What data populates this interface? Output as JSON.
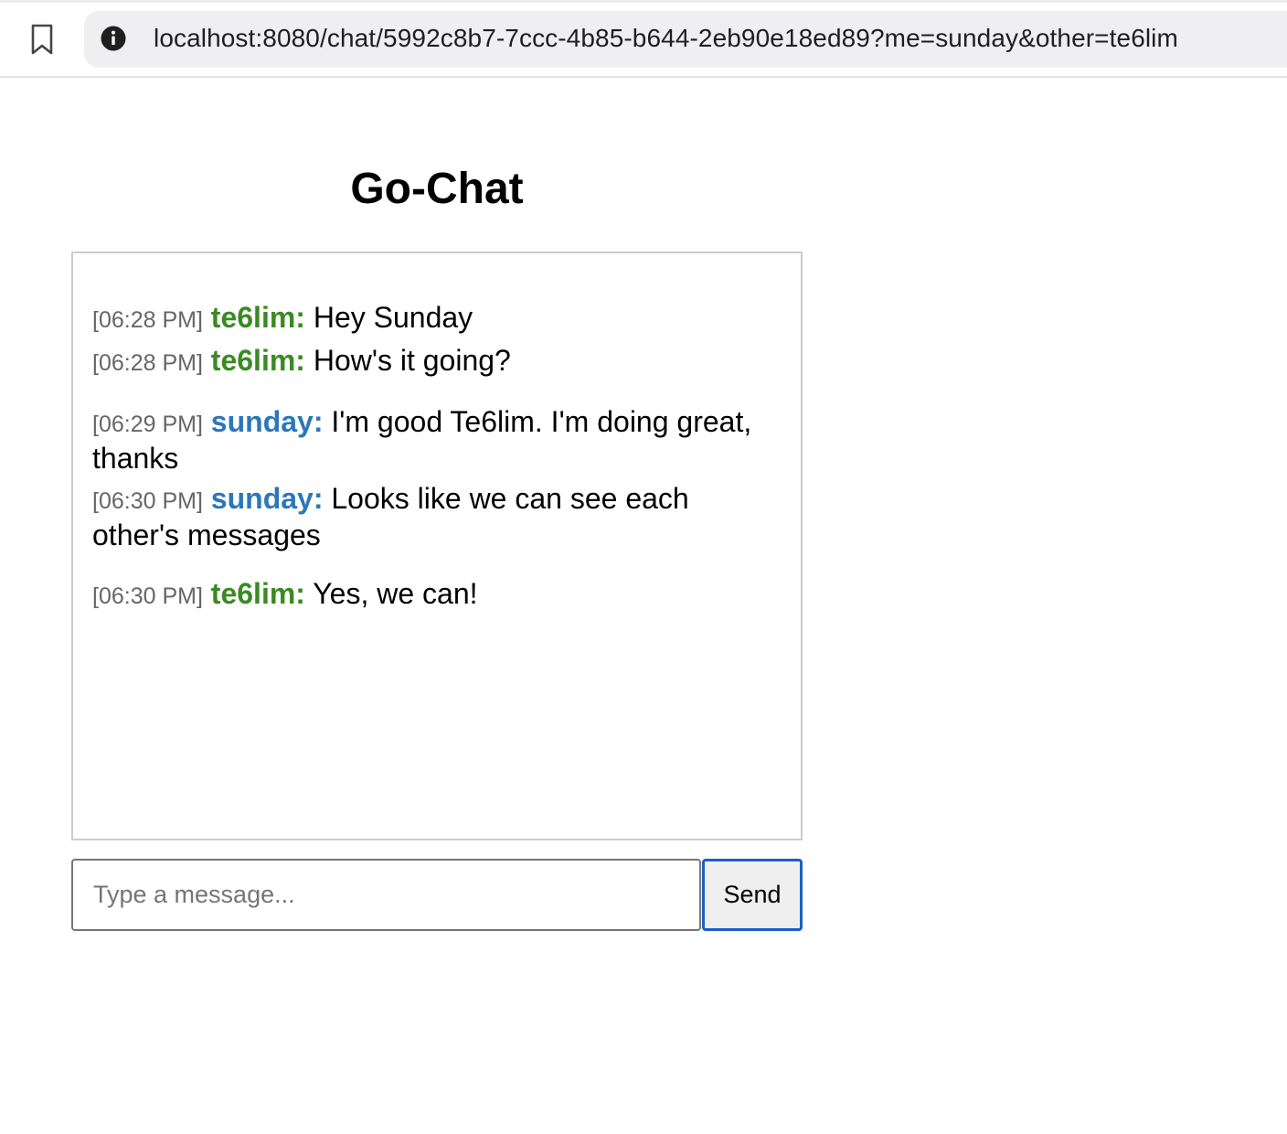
{
  "browser": {
    "url": "localhost:8080/chat/5992c8b7-7ccc-4b85-b644-2eb90e18ed89?me=sunday&other=te6lim"
  },
  "page": {
    "title": "Go-Chat"
  },
  "colors": {
    "other_user": "#3a8a24",
    "me_user": "#2b77b9",
    "timestamp": "#666666",
    "send_border": "#1a5fc8"
  },
  "messages": [
    {
      "time": "[06:28 PM]",
      "user": "te6lim:",
      "text": "Hey Sunday"
    },
    {
      "time": "[06:28 PM]",
      "user": "te6lim:",
      "text": "How's it going?"
    },
    {
      "time": "[06:29 PM]",
      "user": "sunday:",
      "text": "I'm good Te6lim. I'm doing great, thanks"
    },
    {
      "time": "[06:30 PM]",
      "user": "sunday:",
      "text": "Looks like we can see each other's messages"
    },
    {
      "time": "[06:30 PM]",
      "user": "te6lim:",
      "text": "Yes, we can!"
    }
  ],
  "composer": {
    "placeholder": "Type a message...",
    "value": "",
    "send_label": "Send"
  }
}
